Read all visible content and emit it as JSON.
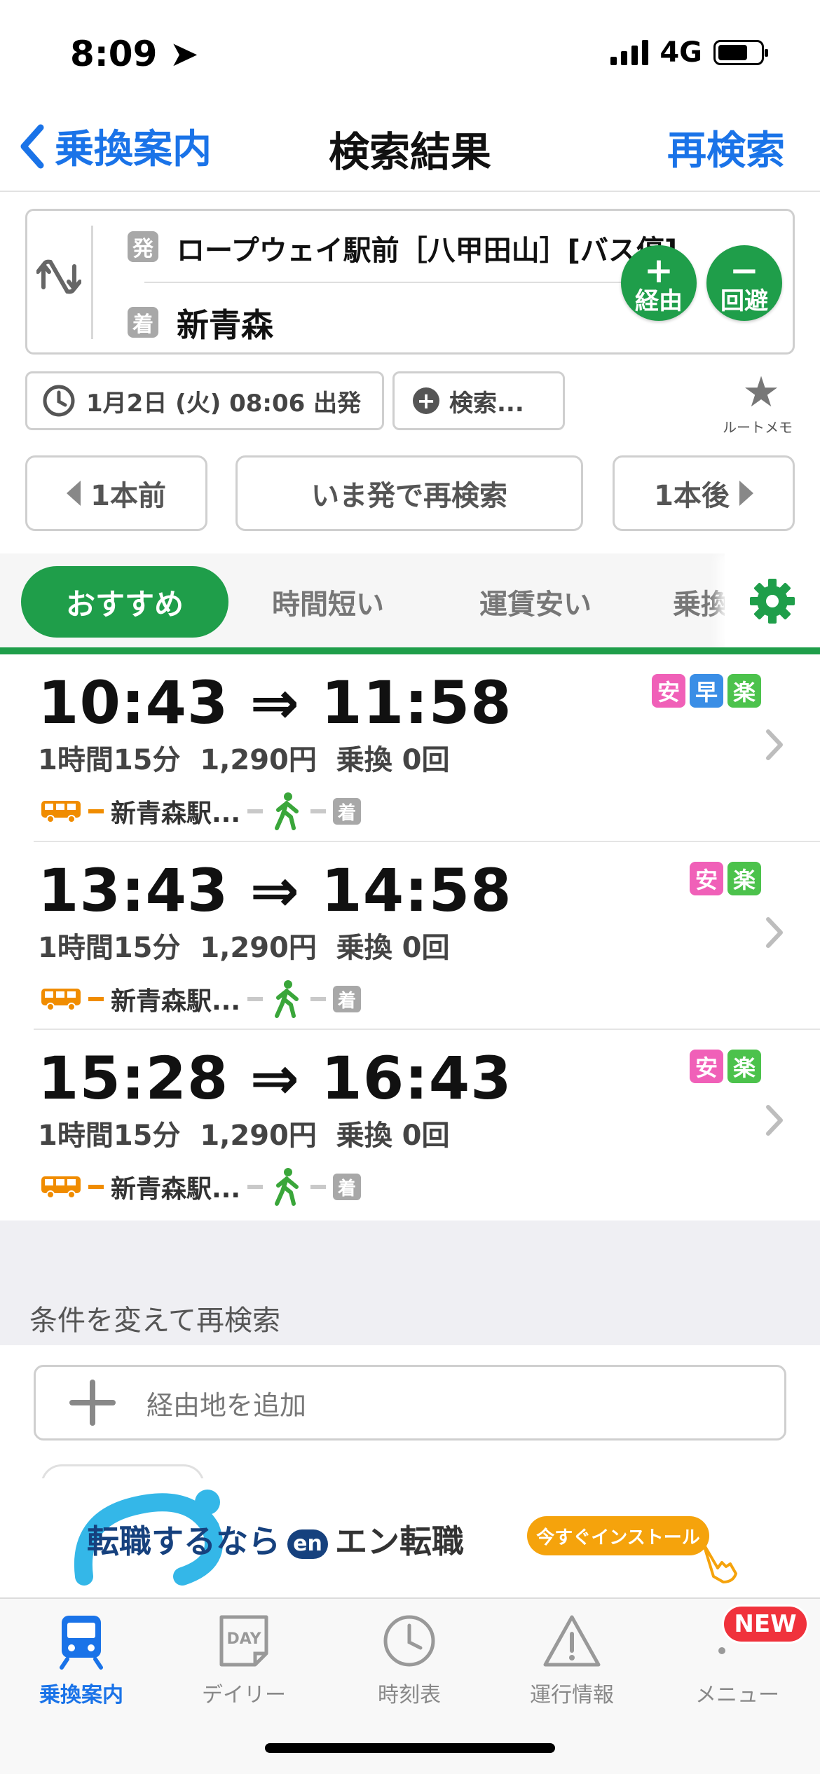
{
  "status_bar": {
    "time": "8:09",
    "network": "4G"
  },
  "nav": {
    "back_label": "乗換案内",
    "title": "検索結果",
    "research_label": "再検索"
  },
  "route": {
    "from_chip": "発",
    "from": "ロープウェイ駅前［八甲田山］[バス停]",
    "to_chip": "着",
    "to": "新青森",
    "via_symbol": "+",
    "via_label": "経由",
    "avoid_symbol": "−",
    "avoid_label": "回避"
  },
  "options": {
    "datetime": "1月2日 (火) 08:06 出発",
    "search_options": "検索...",
    "route_memo": "ルートメモ"
  },
  "nav_buttons": {
    "prev": "1本前",
    "now": "いま発で再検索",
    "next": "1本後"
  },
  "tabs": [
    "おすすめ",
    "時間短い",
    "運賃安い",
    "乗換"
  ],
  "results": [
    {
      "times": "10:43 ⇒ 11:58",
      "duration": "1時間15分",
      "fare": "1,290円",
      "transfers": "乗換 0回",
      "dest_station": "新青森駅...",
      "arrive_chip": "着",
      "badges": [
        {
          "label": "安",
          "color": "#f060b8"
        },
        {
          "label": "早",
          "color": "#3a8ee6"
        },
        {
          "label": "楽",
          "color": "#4cc24c"
        }
      ]
    },
    {
      "times": "13:43 ⇒ 14:58",
      "duration": "1時間15分",
      "fare": "1,290円",
      "transfers": "乗換 0回",
      "dest_station": "新青森駅...",
      "arrive_chip": "着",
      "badges": [
        {
          "label": "安",
          "color": "#f060b8"
        },
        {
          "label": "楽",
          "color": "#4cc24c"
        }
      ]
    },
    {
      "times": "15:28 ⇒ 16:43",
      "duration": "1時間15分",
      "fare": "1,290円",
      "transfers": "乗換 0回",
      "dest_station": "新青森駅...",
      "arrive_chip": "着",
      "badges": [
        {
          "label": "安",
          "color": "#f060b8"
        },
        {
          "label": "楽",
          "color": "#4cc24c"
        }
      ]
    }
  ],
  "conditions": {
    "label": "条件を変えて再検索",
    "add_via": "経由地を追加"
  },
  "ad": {
    "text": "転職するなら",
    "logo_mark": "en",
    "brand": "エン転職",
    "cta": "今すぐインストール"
  },
  "tabbar": {
    "items": [
      "乗換案内",
      "デイリー",
      "時刻表",
      "運行情報",
      "メニュー"
    ],
    "daily_icon_text": "DAY",
    "new_badge": "NEW"
  },
  "colors": {
    "accent_green": "#1f9e4a",
    "link_blue": "#1a73e8",
    "bus_orange": "#f08c00",
    "new_red": "#f0323c"
  }
}
